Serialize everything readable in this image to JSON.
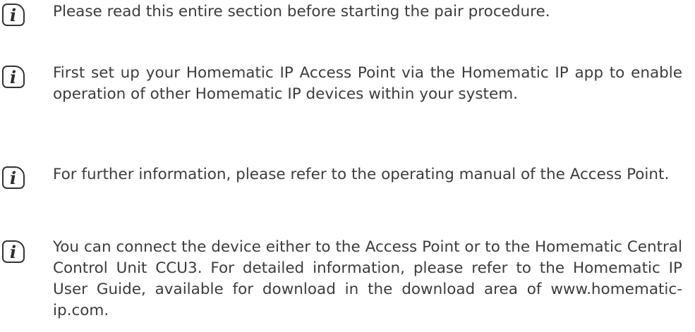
{
  "notes": [
    {
      "icon": "info-icon",
      "glyph": "i",
      "text": "Please read this entire section before starting the pair procedure."
    },
    {
      "icon": "info-icon",
      "glyph": "i",
      "text": "First set up your Homematic IP Access Point via the Homematic IP app to enable operation of other Homematic IP devices within your system."
    },
    {
      "icon": "info-icon",
      "glyph": "i",
      "text": "For further information, please refer to the operating manual of the Access Point."
    },
    {
      "icon": "info-icon",
      "glyph": "i",
      "text": "You can connect the device either to the Access Point or to the Homematic Central Control Unit CCU3. For detailed information, please refer to the Homematic IP User Guide, available for download in the download area of www.homematic-ip.com."
    }
  ]
}
